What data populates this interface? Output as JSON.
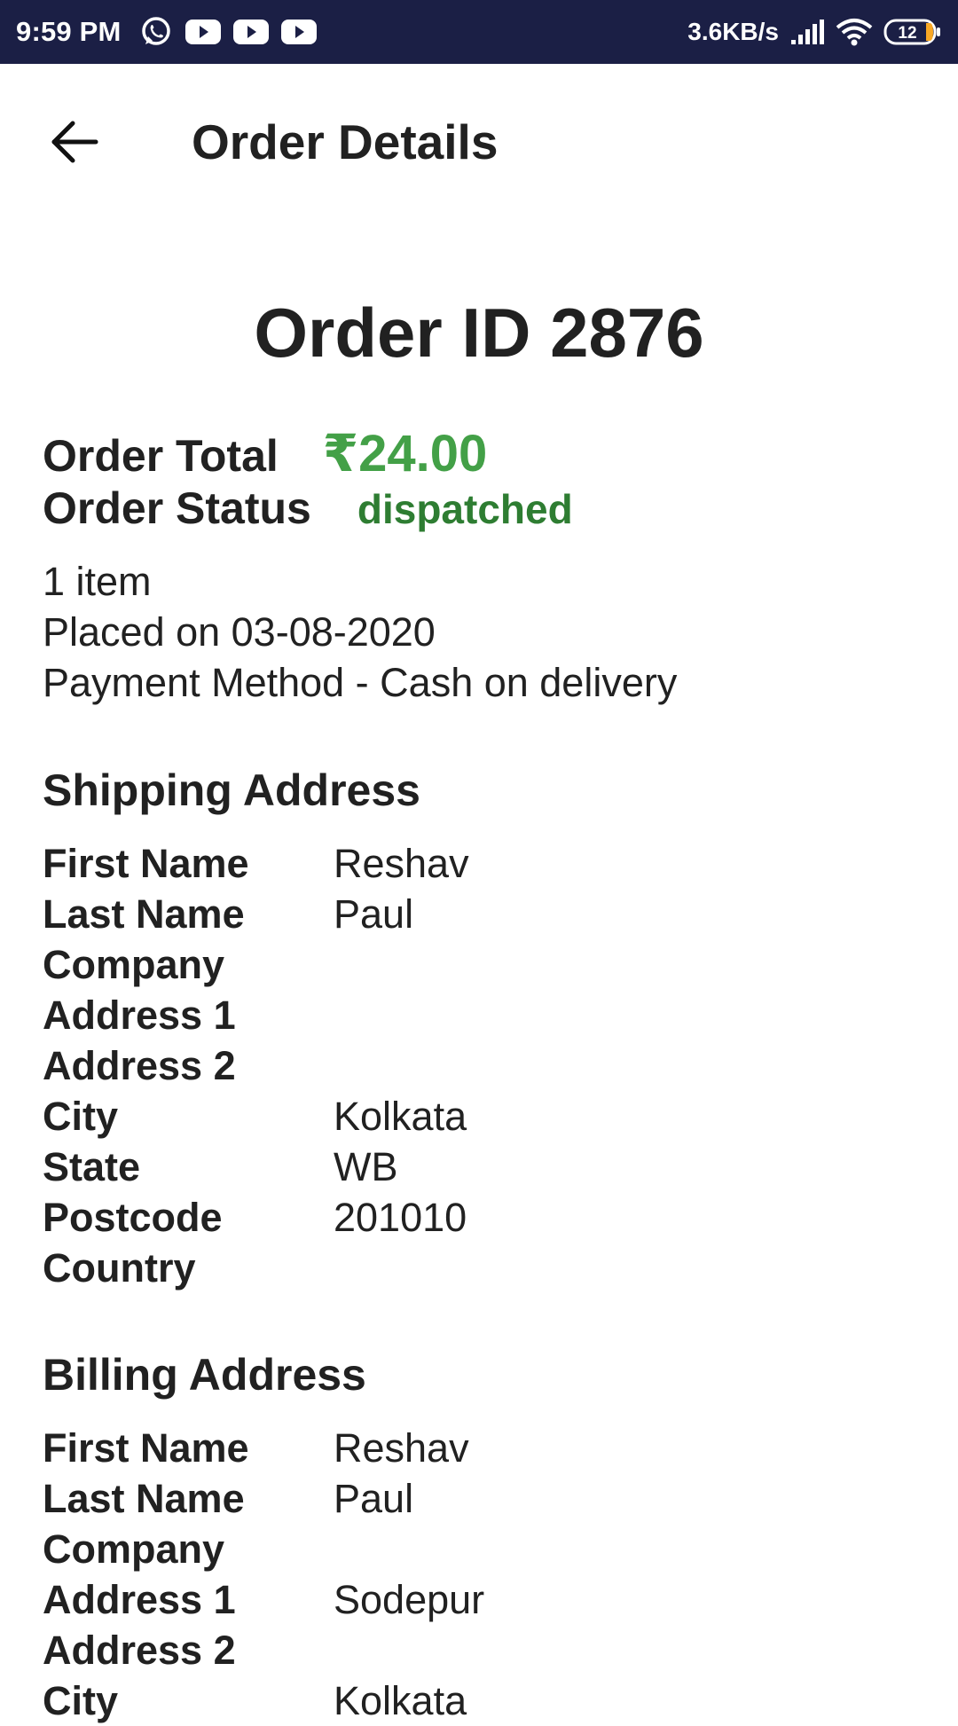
{
  "status_bar": {
    "time": "9:59 PM",
    "net_speed": "3.6KB/s",
    "battery": "12",
    "icons": [
      "whatsapp-icon",
      "youtube-icon",
      "youtube-icon",
      "youtube-icon",
      "signal-icon",
      "wifi-icon",
      "battery-icon"
    ]
  },
  "app_bar": {
    "title": "Order Details",
    "back_icon": "arrow-back-icon"
  },
  "order": {
    "id_text": "Order ID 2876",
    "total_label": "Order Total",
    "total_value": "₹24.00",
    "status_label": "Order Status",
    "status_value": "dispatched",
    "items": "1 item",
    "placed_on": "Placed on 03-08-2020",
    "payment": "Payment Method - Cash on delivery"
  },
  "shipping": {
    "title": "Shipping Address",
    "rows": [
      {
        "label": "First Name",
        "value": "Reshav"
      },
      {
        "label": "Last Name",
        "value": "Paul"
      },
      {
        "label": "Company",
        "value": ""
      },
      {
        "label": "Address 1",
        "value": ""
      },
      {
        "label": "Address 2",
        "value": ""
      },
      {
        "label": "City",
        "value": "Kolkata"
      },
      {
        "label": "State",
        "value": "WB"
      },
      {
        "label": "Postcode",
        "value": "201010"
      },
      {
        "label": "Country",
        "value": ""
      }
    ]
  },
  "billing": {
    "title": "Billing Address",
    "rows": [
      {
        "label": "First Name",
        "value": "Reshav"
      },
      {
        "label": "Last Name",
        "value": "Paul"
      },
      {
        "label": "Company",
        "value": ""
      },
      {
        "label": "Address 1",
        "value": "Sodepur"
      },
      {
        "label": "Address 2",
        "value": ""
      },
      {
        "label": "City",
        "value": "Kolkata"
      }
    ]
  },
  "colors": {
    "status_bar_bg": "#1b1f45",
    "total_green": "#43a047",
    "status_green": "#2e7d32",
    "text": "#212121"
  }
}
